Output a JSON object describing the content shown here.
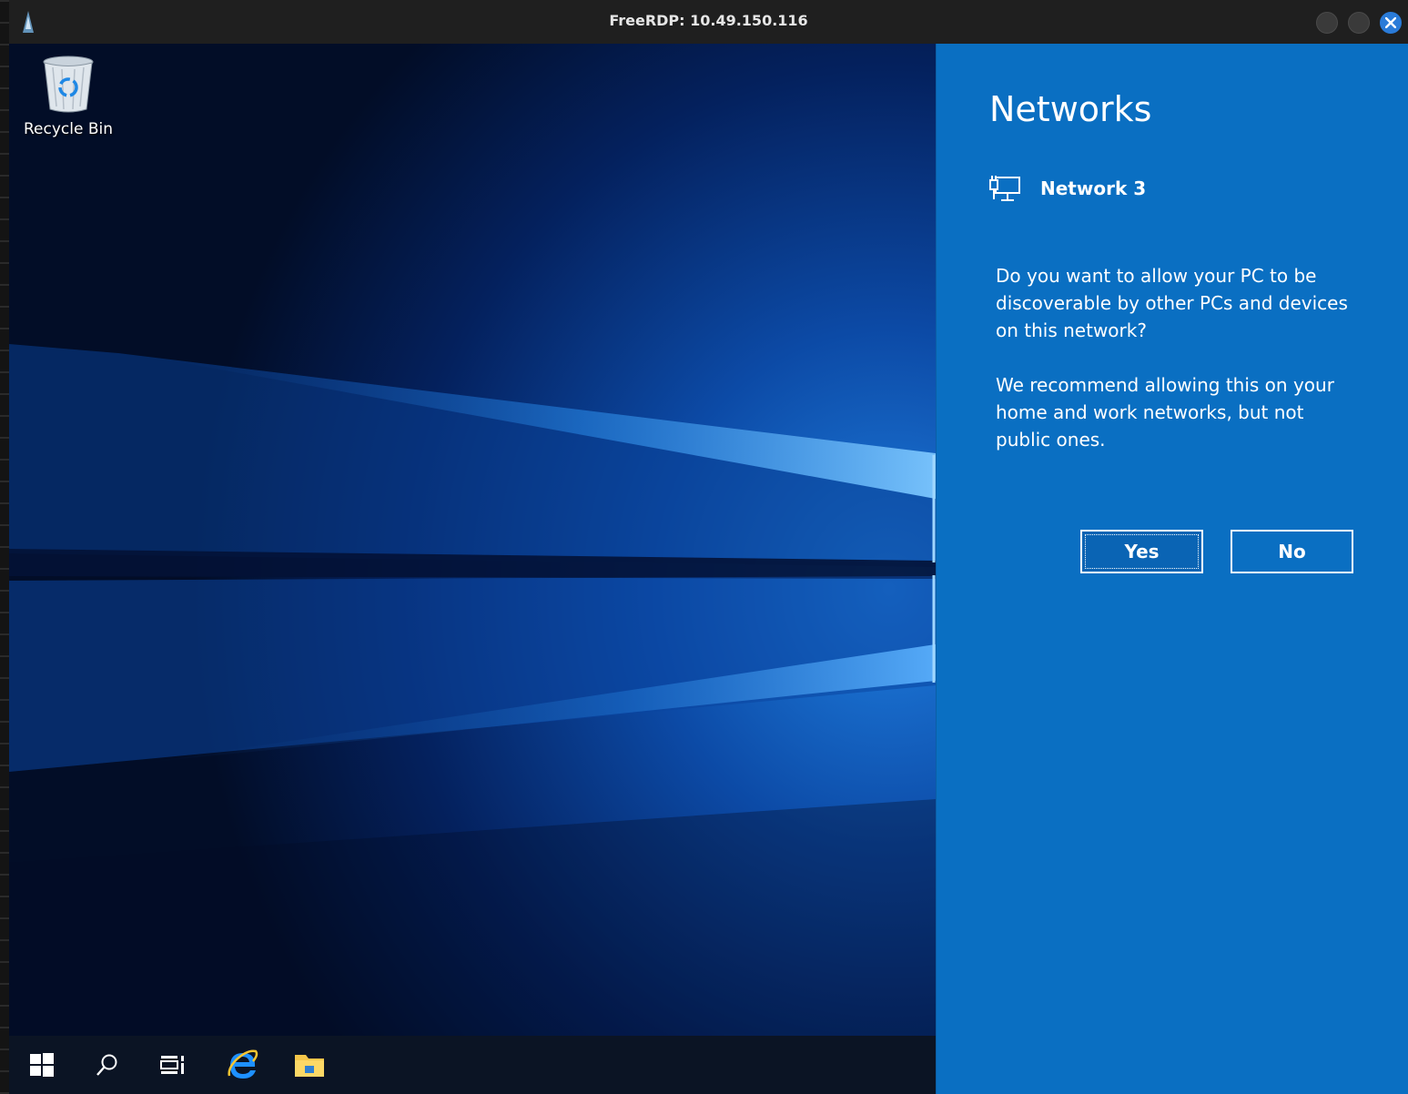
{
  "window": {
    "title": "FreeRDP: 10.49.150.116",
    "close_color": "#2a7bd8"
  },
  "desktop": {
    "icons": [
      {
        "label": "Recycle Bin",
        "icon": "recycle-bin-icon"
      }
    ]
  },
  "taskbar": {
    "items": [
      {
        "name": "start-icon"
      },
      {
        "name": "search-icon"
      },
      {
        "name": "task-view-icon"
      },
      {
        "name": "internet-explorer-icon"
      },
      {
        "name": "file-explorer-icon"
      }
    ]
  },
  "flyout": {
    "title": "Networks",
    "network_name": "Network 3",
    "network_icon": "ethernet-icon",
    "question": "Do you want to allow your PC to be discoverable by other PCs and devices on this network?",
    "recommendation": "We recommend allowing this on your home and work networks, but not public ones.",
    "yes_label": "Yes",
    "no_label": "No",
    "background_color": "#0a6fc2"
  }
}
